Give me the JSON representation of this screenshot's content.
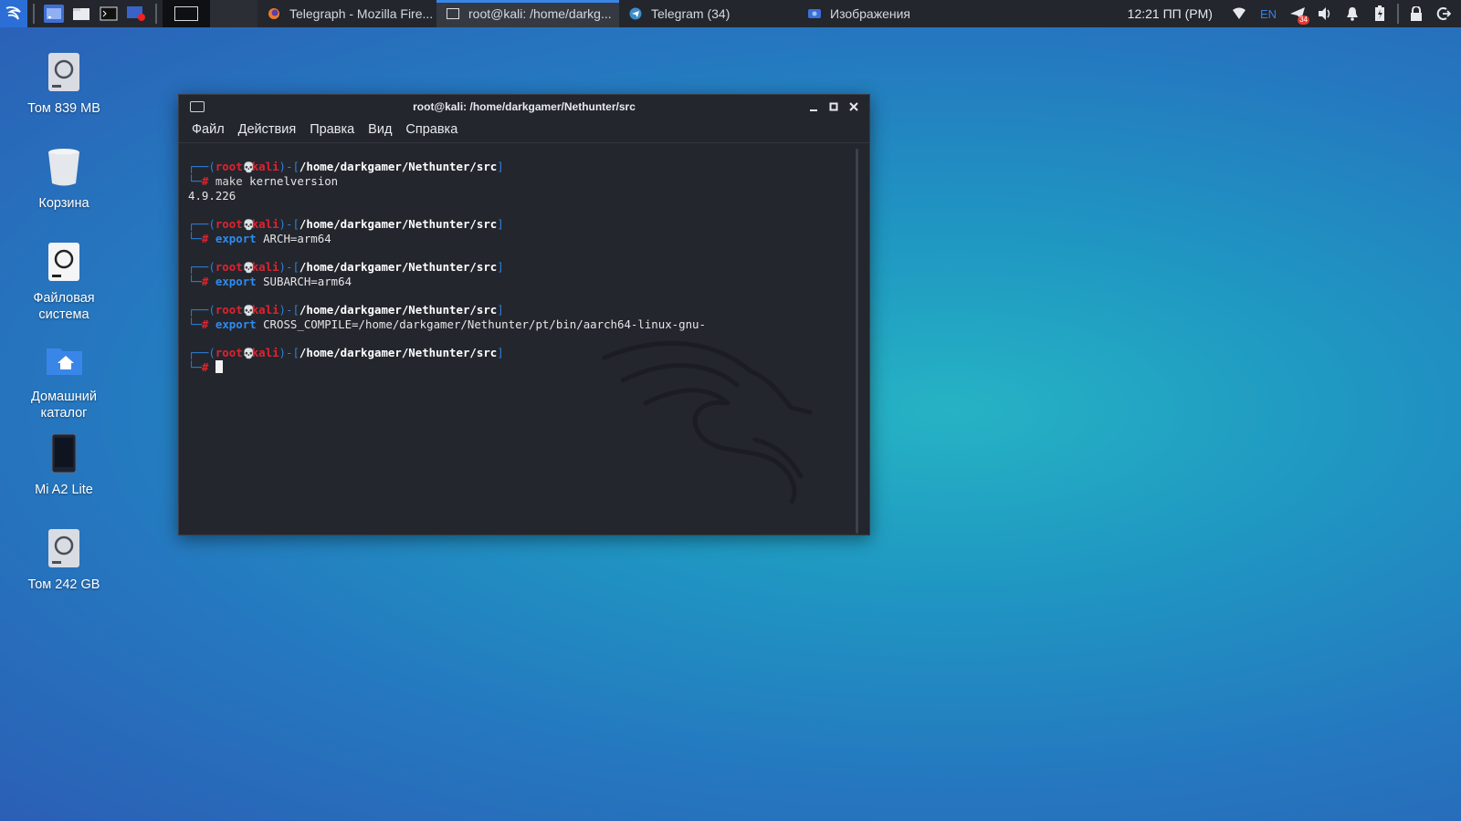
{
  "taskbar": {
    "tasks": [
      {
        "title": "Telegraph - Mozilla Fire...",
        "icon": "firefox-icon"
      },
      {
        "title": "root@kali: /home/darkg...",
        "icon": "terminal-icon"
      },
      {
        "title": "Telegram (34)",
        "icon": "telegram-icon"
      },
      {
        "title": "Изображения",
        "icon": "image-viewer-icon"
      }
    ],
    "clock": "12:21 ПП (PM)",
    "language": "EN",
    "telegram_badge": "34"
  },
  "desktop": {
    "icons": [
      {
        "label": "Том 839 MB",
        "icon": "drive-icon"
      },
      {
        "label": "Корзина",
        "icon": "trash-icon"
      },
      {
        "label": "Файловая система",
        "icon": "filesystem-icon"
      },
      {
        "label": "Домашний каталог",
        "icon": "home-folder-icon"
      },
      {
        "label": "Mi A2 Lite",
        "icon": "phone-icon"
      },
      {
        "label": "Том 242 GB",
        "icon": "drive-icon"
      }
    ]
  },
  "terminal": {
    "title": "root@kali: /home/darkgamer/Nethunter/src",
    "menu": [
      "Файл",
      "Действия",
      "Правка",
      "Вид",
      "Справка"
    ],
    "prompt": {
      "user": "root",
      "host": "kali",
      "path": "/home/darkgamer/Nethunter/src",
      "symbol": "#"
    },
    "commands": [
      {
        "keyword": "",
        "cmd": "make",
        "args": " kernelversion",
        "output": "4.9.226"
      },
      {
        "keyword": "export",
        "cmd": "",
        "args": " ARCH=arm64",
        "output": ""
      },
      {
        "keyword": "export",
        "cmd": "",
        "args": " SUBARCH=arm64",
        "output": ""
      },
      {
        "keyword": "export",
        "cmd": "",
        "args": " CROSS_COMPILE=/home/darkgamer/Nethunter/pt/bin/aarch64-linux-gnu-",
        "output": ""
      }
    ]
  },
  "colors": {
    "accent": "#2b6fd6",
    "prompt_user": "#e0232f",
    "prompt_frame": "#2d7fd9"
  }
}
